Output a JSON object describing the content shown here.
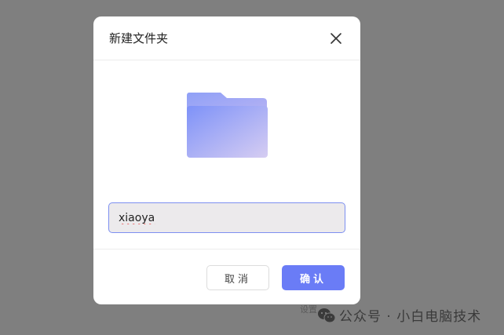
{
  "dialog": {
    "title": "新建文件夹",
    "input_value": "xiaoya",
    "cancel_label": "取消",
    "ok_label": "确认"
  },
  "background": {
    "partial_text": "设置"
  },
  "watermark": {
    "text": "公众号 · 小白电脑技术"
  },
  "colors": {
    "overlay": "#7f7f7f",
    "accent": "#6a7cf6",
    "input_border": "#7d8ff0",
    "folder_start": "#7e92f8",
    "folder_end": "#d6cdf2"
  },
  "icons": [
    "close-icon",
    "folder-icon",
    "wechat-icon"
  ]
}
